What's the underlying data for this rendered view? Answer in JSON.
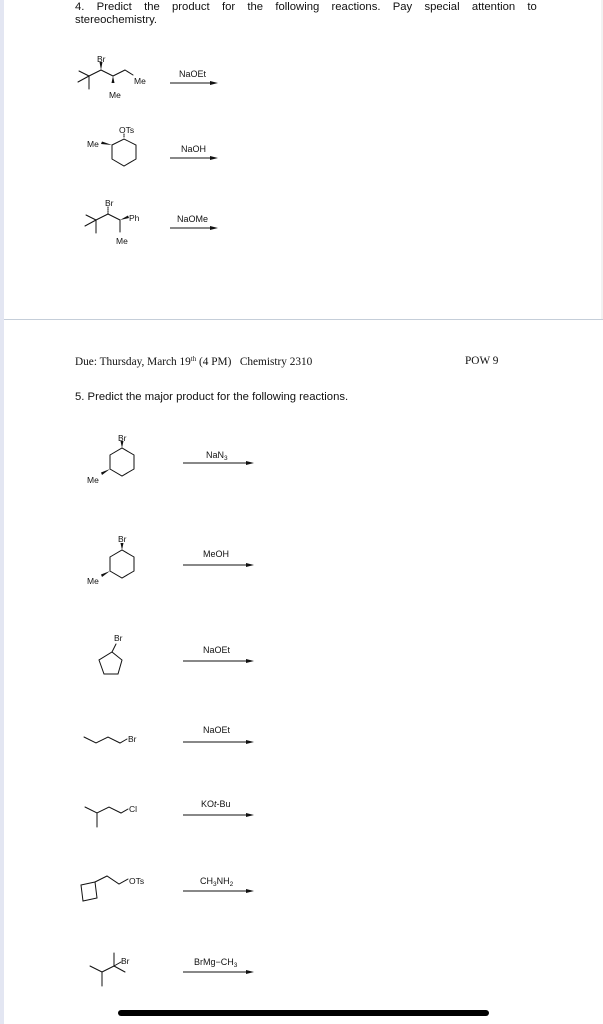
{
  "question4": {
    "line1_words": [
      "4.",
      "Predict",
      "the",
      "product",
      "for",
      "the",
      "following",
      "reactions.",
      "Pay",
      "special",
      "attention",
      "to"
    ],
    "line2": "stereochemistry.",
    "reactions": [
      {
        "substrate": "2-bromo-3-methyl pentane with tert-butyl; Br wedge, Me wedge",
        "labels": {
          "br": "Br",
          "me1": "Me",
          "me2": "Me"
        },
        "reagent": "NaOEt"
      },
      {
        "substrate": "cyclohexane with OTs hash and Me wedge",
        "labels": {
          "ots": "OTs",
          "me": "Me"
        },
        "reagent": "NaOH"
      },
      {
        "substrate": "tert-butyl with Br hash, Ph wedge, Me",
        "labels": {
          "br": "Br",
          "ph": "Ph",
          "me": "Me"
        },
        "reagent": "NaOMe"
      }
    ]
  },
  "header": {
    "due_prefix": "Due: Thursday, March 19",
    "due_sup": "th",
    "due_suffix": " (4 PM)   Chemistry 2310",
    "pow": "POW 9"
  },
  "question5": {
    "title": "5. Predict the major product for the following reactions.",
    "reactions": [
      {
        "labels": {
          "br": "Br",
          "me": "Me"
        },
        "reagent_main": "NaN",
        "reagent_sub": "3"
      },
      {
        "labels": {
          "br": "Br",
          "me": "Me"
        },
        "reagent": "MeOH"
      },
      {
        "labels": {
          "br": "Br"
        },
        "reagent": "NaOEt"
      },
      {
        "labels": {
          "br": "Br"
        },
        "reagent": "NaOEt"
      },
      {
        "labels": {
          "cl": "Cl"
        },
        "reagent_pre": "KO",
        "reagent_italic": "t",
        "reagent_post": "-Bu"
      },
      {
        "labels": {
          "ots": "OTs"
        },
        "reagent_parts": [
          "CH",
          "3",
          "NH",
          "2"
        ]
      },
      {
        "labels": {
          "br": "Br"
        },
        "reagent_pre": "BrMg−CH",
        "reagent_sub": "3"
      }
    ]
  }
}
